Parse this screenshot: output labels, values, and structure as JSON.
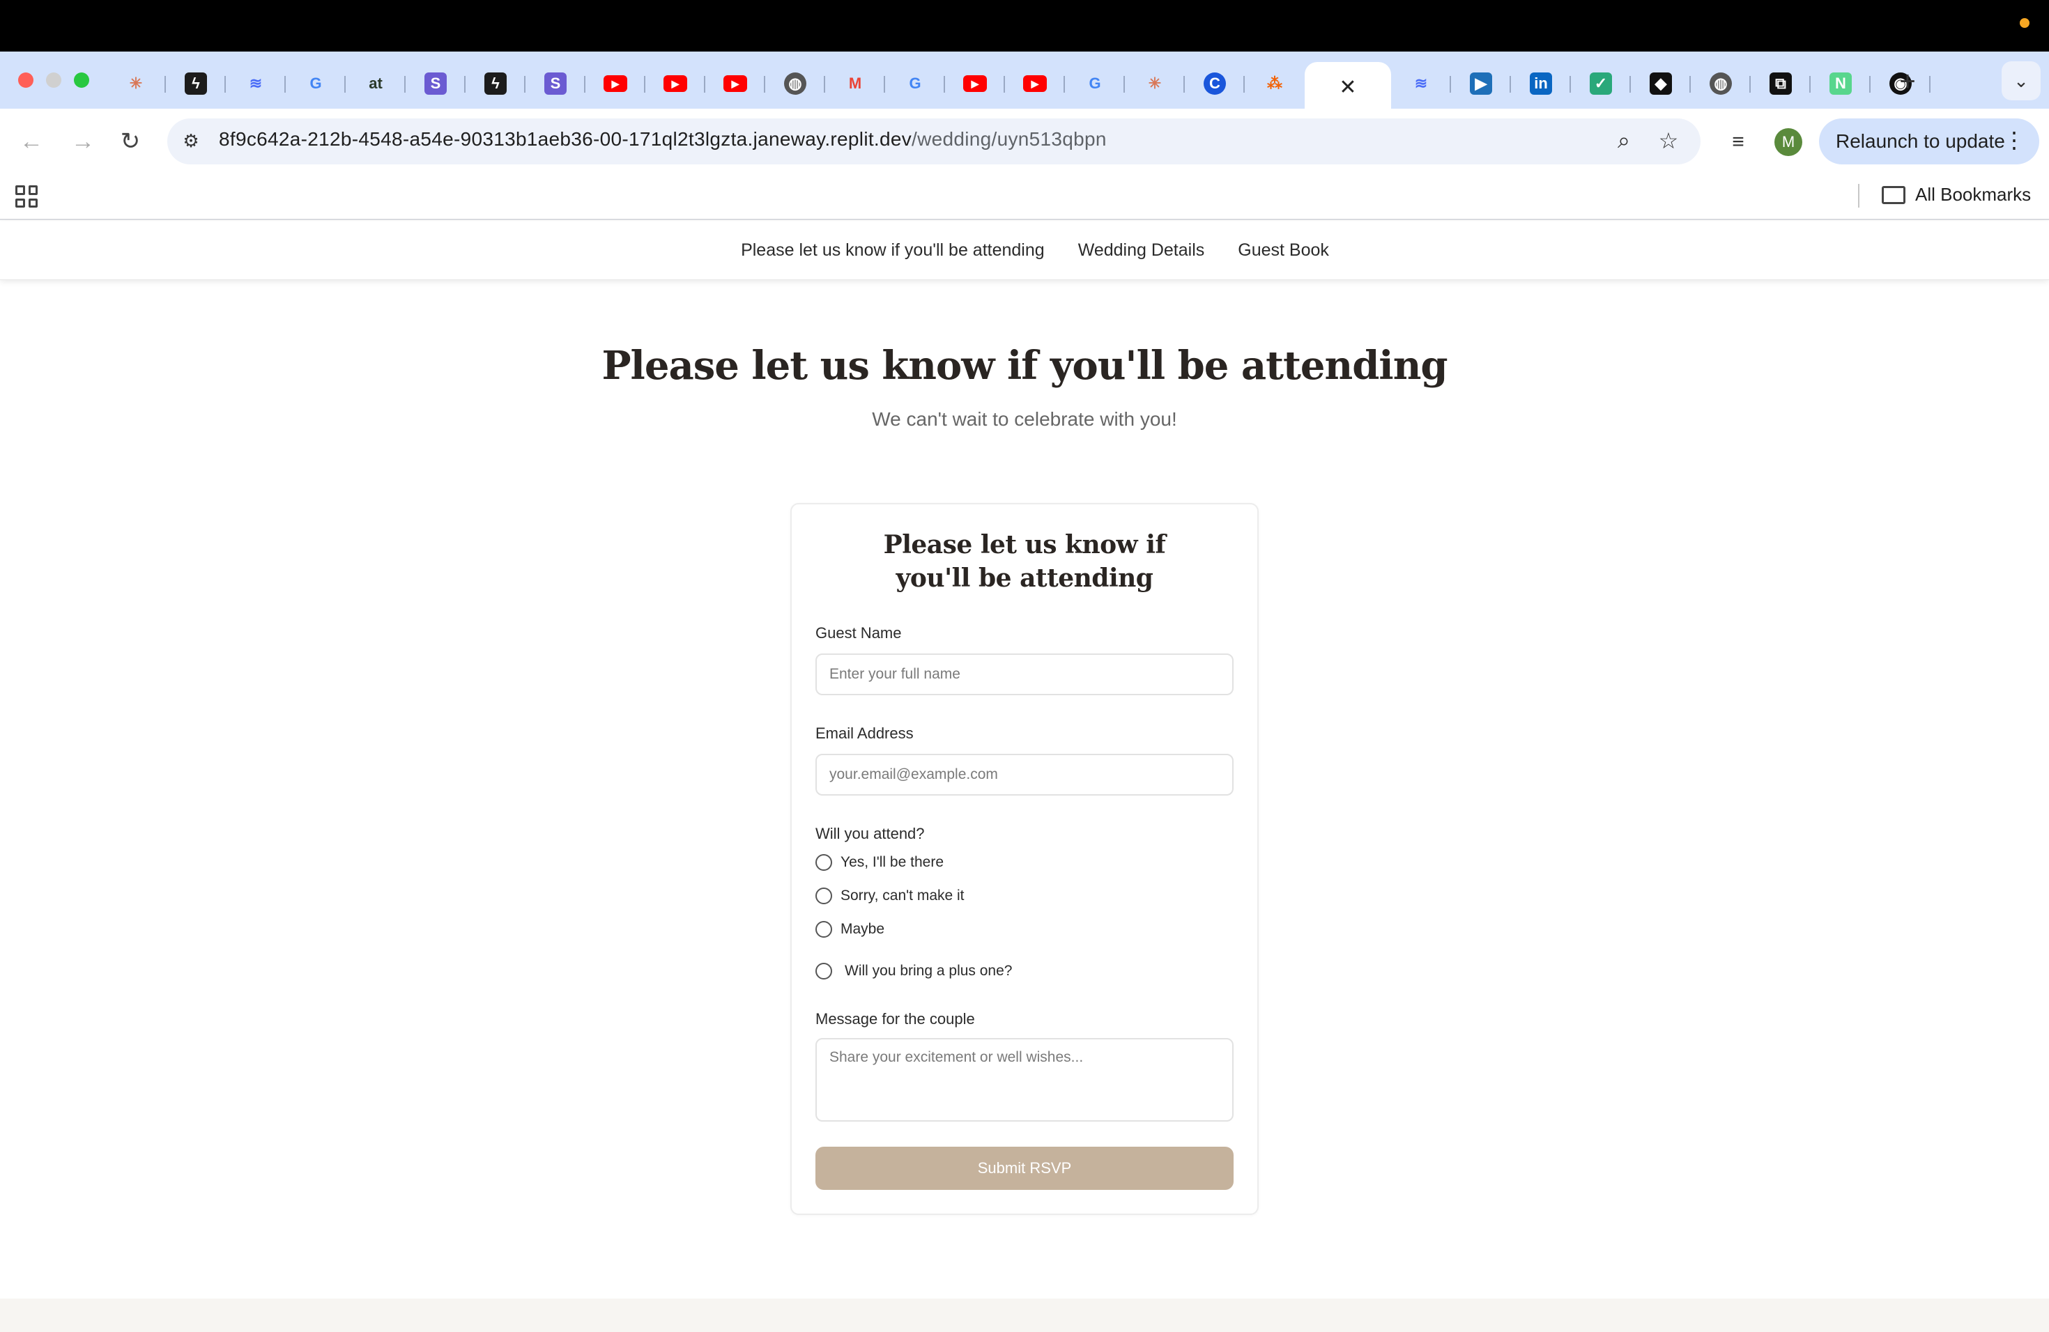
{
  "browser": {
    "tabs": [
      {
        "icon": "claude-sunburst-icon",
        "color": "#d97757"
      },
      {
        "icon": "supabase-bolt-icon",
        "color": "#1c1c1c"
      },
      {
        "icon": "whale-icon",
        "color": "#4a6cf7"
      },
      {
        "icon": "google-g-icon",
        "color": "#4285f4"
      },
      {
        "icon": "at-logo-icon",
        "color": "#2b3a2b"
      },
      {
        "icon": "s-square-icon",
        "color": "#6b5bd2"
      },
      {
        "icon": "supabase-bolt-icon",
        "color": "#1c1c1c"
      },
      {
        "icon": "s-square-icon",
        "color": "#6b5bd2"
      },
      {
        "icon": "youtube-icon",
        "color": "#ff0000"
      },
      {
        "icon": "youtube-icon",
        "color": "#ff0000"
      },
      {
        "icon": "youtube-icon",
        "color": "#ff0000"
      },
      {
        "icon": "globe-icon",
        "color": "#555555"
      },
      {
        "icon": "gmail-icon",
        "color": "#ea4335"
      },
      {
        "icon": "google-g-icon",
        "color": "#4285f4"
      },
      {
        "icon": "youtube-icon",
        "color": "#ff0000"
      },
      {
        "icon": "youtube-icon",
        "color": "#ff0000"
      },
      {
        "icon": "google-g-icon",
        "color": "#4285f4"
      },
      {
        "icon": "claude-sunburst-icon",
        "color": "#d97757"
      },
      {
        "icon": "c-circle-icon",
        "color": "#1a56db"
      },
      {
        "icon": "replit-icon",
        "color": "#f26207"
      }
    ],
    "active_tab": {
      "icon": "close-icon",
      "glyph": "✕"
    },
    "tabs_after": [
      {
        "icon": "whale-icon",
        "color": "#4a6cf7"
      },
      {
        "icon": "play-video-icon",
        "color": "#1e6fb8"
      },
      {
        "icon": "linkedin-icon",
        "color": "#0a66c2"
      },
      {
        "icon": "checklist-icon",
        "color": "#2aa87a"
      },
      {
        "icon": "cube-check-icon",
        "color": "#111111"
      },
      {
        "icon": "globe-icon",
        "color": "#555555"
      },
      {
        "icon": "link-icon",
        "color": "#111111"
      },
      {
        "icon": "n-square-icon",
        "color": "#58d68d"
      },
      {
        "icon": "github-icon",
        "color": "#111111"
      }
    ],
    "url_host": "8f9c642a-212b-4548-a54e-90313b1aeb36-00-171ql2t3lgzta.janeway.replit.dev",
    "url_path": "/wedding/uyn513qbpn",
    "relaunch_label": "Relaunch to update",
    "avatar_initial": "M",
    "all_bookmarks_label": "All Bookmarks"
  },
  "site": {
    "nav": {
      "rsvp": "Please let us know if you'll be attending",
      "details": "Wedding Details",
      "guestbook": "Guest Book"
    },
    "hero": {
      "title": "Please let us know if you'll be attending",
      "subtitle": "We can't wait to celebrate with you!"
    },
    "form": {
      "title": "Please let us know if you'll be attending",
      "name_label": "Guest Name",
      "name_placeholder": "Enter your full name",
      "email_label": "Email Address",
      "email_placeholder": "your.email@example.com",
      "attend_label": "Will you attend?",
      "attend_options": [
        "Yes, I'll be there",
        "Sorry, can't make it",
        "Maybe"
      ],
      "plus_one_label": "Will you bring a plus one?",
      "message_label": "Message for the couple",
      "message_placeholder": "Share your excitement or well wishes...",
      "submit_label": "Submit RSVP"
    }
  },
  "colors": {
    "submit": "#c5b29c",
    "tabstrip": "#d3e2fc"
  }
}
